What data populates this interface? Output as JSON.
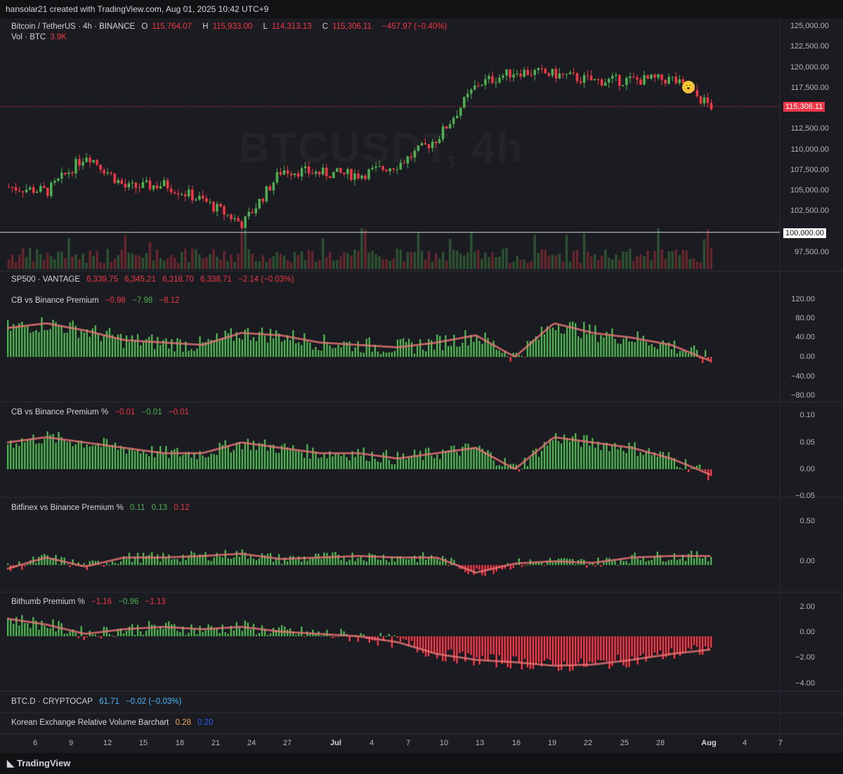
{
  "header": {
    "credit": "hansolar21 created with TradingView.com, Aug 01, 2025 10:42 UTC+9"
  },
  "main_pane": {
    "symbol": "Bitcoin / TetherUS · 4h · BINANCE",
    "o_label": "O",
    "o_value": "115,764.07",
    "h_label": "H",
    "h_value": "115,933.00",
    "l_label": "L",
    "l_value": "114,313.13",
    "c_label": "C",
    "c_value": "115,306.11",
    "change": "−457.97 (−0.40%)",
    "vol_label": "Vol · BTC",
    "vol_value": "3.9K",
    "watermark": "BTCUSDT, 4h",
    "last_price": "115,306.11",
    "level_label": "100,000.00",
    "y_ticks": [
      "125,000.00",
      "122,500.00",
      "120,000.00",
      "117,500.00",
      "112,500.00",
      "110,000.00",
      "107,500.00",
      "105,000.00",
      "102,500.00",
      "97,500.00"
    ]
  },
  "pane_sp500": {
    "title": "SP500 · VANTAGE",
    "v1": "6,339.75",
    "v2": "6,345.21",
    "v3": "6,318.70",
    "v4": "6,338.71",
    "v5": "−2.14 (−0.03%)"
  },
  "pane_cb": {
    "title": "CB vs Binance Premium",
    "v1": "−0.98",
    "v2": "−7.98",
    "v3": "−8.12",
    "y_ticks": [
      "120.00",
      "80.00",
      "40.00",
      "0.00",
      "−40.00",
      "−80.00"
    ]
  },
  "pane_cbpct": {
    "title": "CB vs Binance Premium %",
    "v1": "−0.01",
    "v2": "−0.01",
    "v3": "−0.01",
    "y_ticks": [
      "0.10",
      "0.05",
      "0.00",
      "−0.05"
    ]
  },
  "pane_bitfinex": {
    "title": "Bitfinex vs Binance Premium %",
    "v1": "0.11",
    "v2": "0.13",
    "v3": "0.12",
    "y_ticks": [
      "0.50",
      "0.00"
    ]
  },
  "pane_bithumb": {
    "title": "Bithumb Premium %",
    "v1": "−1.16",
    "v2": "−0.96",
    "v3": "−1.13",
    "y_ticks": [
      "2.00",
      "0.00",
      "−2.00",
      "−4.00"
    ]
  },
  "pane_btcd": {
    "title": "BTC.D · CRYPTOCAP",
    "v1": "61.71",
    "v2": "−0.02 (−0.03%)"
  },
  "pane_korean": {
    "title": "Korean Exchange Relative Volume Barchart",
    "v1": "0.28",
    "v2": "0.20"
  },
  "x_axis": [
    "6",
    "9",
    "12",
    "15",
    "18",
    "21",
    "24",
    "27",
    "Jul",
    "4",
    "7",
    "10",
    "13",
    "16",
    "19",
    "22",
    "25",
    "28",
    "Aug",
    "4",
    "7"
  ],
  "footer": {
    "brand": "TradingView"
  },
  "colors": {
    "up": "#4caf50",
    "down": "#f23645",
    "bg": "#1b1c21"
  },
  "chart_data": {
    "type": "line",
    "title": "Bitcoin / TetherUS · 4h · BINANCE",
    "x": [
      "6",
      "9",
      "12",
      "15",
      "18",
      "21",
      "24",
      "27",
      "Jul",
      "4",
      "7",
      "10",
      "13",
      "16",
      "19",
      "22",
      "25",
      "28",
      "Aug"
    ],
    "series": [
      {
        "name": "BTCUSDT close",
        "values": [
          105500,
          105000,
          109500,
          105400,
          105800,
          103800,
          101000,
          107600,
          107200,
          107000,
          108300,
          111500,
          118000,
          119600,
          119200,
          118400,
          118500,
          118600,
          115306
        ]
      },
      {
        "name": "CB vs Binance Premium",
        "values": [
          60,
          70,
          55,
          35,
          30,
          25,
          50,
          45,
          30,
          25,
          20,
          30,
          45,
          0,
          70,
          50,
          40,
          25,
          -8
        ]
      },
      {
        "name": "CB vs Binance Premium %",
        "values": [
          0.05,
          0.06,
          0.05,
          0.04,
          0.03,
          0.03,
          0.05,
          0.04,
          0.03,
          0.03,
          0.02,
          0.03,
          0.04,
          0,
          0.06,
          0.05,
          0.04,
          0.02,
          -0.01
        ]
      },
      {
        "name": "Bitfinex vs Binance Premium %",
        "values": [
          -0.05,
          0.1,
          -0.02,
          0.1,
          0.1,
          0.12,
          0.15,
          0.08,
          0.1,
          0.12,
          0.1,
          0.1,
          -0.1,
          0.02,
          0.05,
          0.03,
          0.1,
          0.12,
          0.12
        ]
      },
      {
        "name": "Bithumb Premium %",
        "values": [
          1.5,
          1.0,
          0.2,
          0.6,
          0.8,
          0.6,
          0.8,
          0.4,
          0.2,
          0.0,
          -0.5,
          -1.5,
          -2.0,
          -2.2,
          -2.5,
          -2.4,
          -2.0,
          -1.5,
          -1.13
        ]
      }
    ],
    "ylim": [
      97500,
      125000
    ]
  }
}
